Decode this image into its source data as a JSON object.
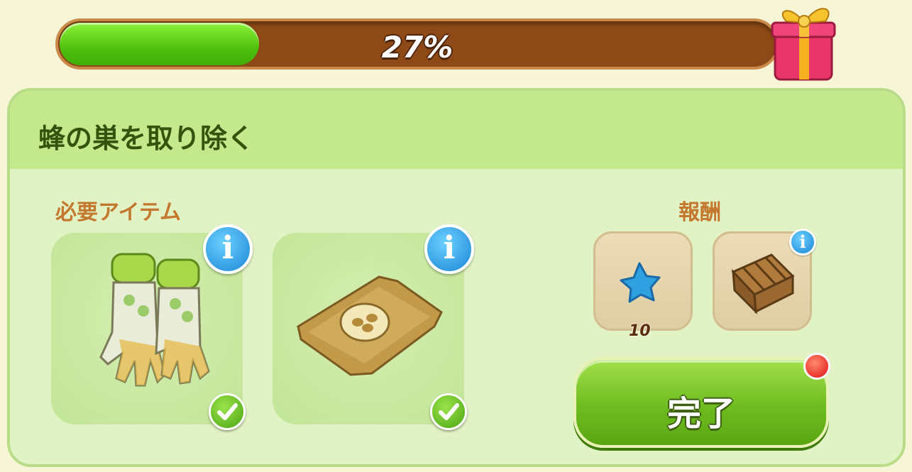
{
  "progress": {
    "value_percent": 27,
    "label": "27%"
  },
  "panel": {
    "title": "蜂の巣を取り除く",
    "required_items_label": "必要アイテム",
    "rewards_label": "報酬"
  },
  "required_items": [
    {
      "icon": "gardening-gloves-icon",
      "completed": true
    },
    {
      "icon": "seed-bag-icon",
      "completed": true
    }
  ],
  "rewards": [
    {
      "icon": "blue-star-icon",
      "count": "10"
    },
    {
      "icon": "wooden-crate-icon"
    }
  ],
  "info_symbol": "i",
  "complete_button": {
    "label": "完了"
  },
  "colors": {
    "progress_fill": "#4fc10e",
    "progress_track": "#8d4a16",
    "panel_bg": "#e1f2c4",
    "header_bg": "#c4e88c",
    "title_text": "#36530e",
    "section_label": "#c4782e",
    "button_green": "#6ebc20"
  }
}
